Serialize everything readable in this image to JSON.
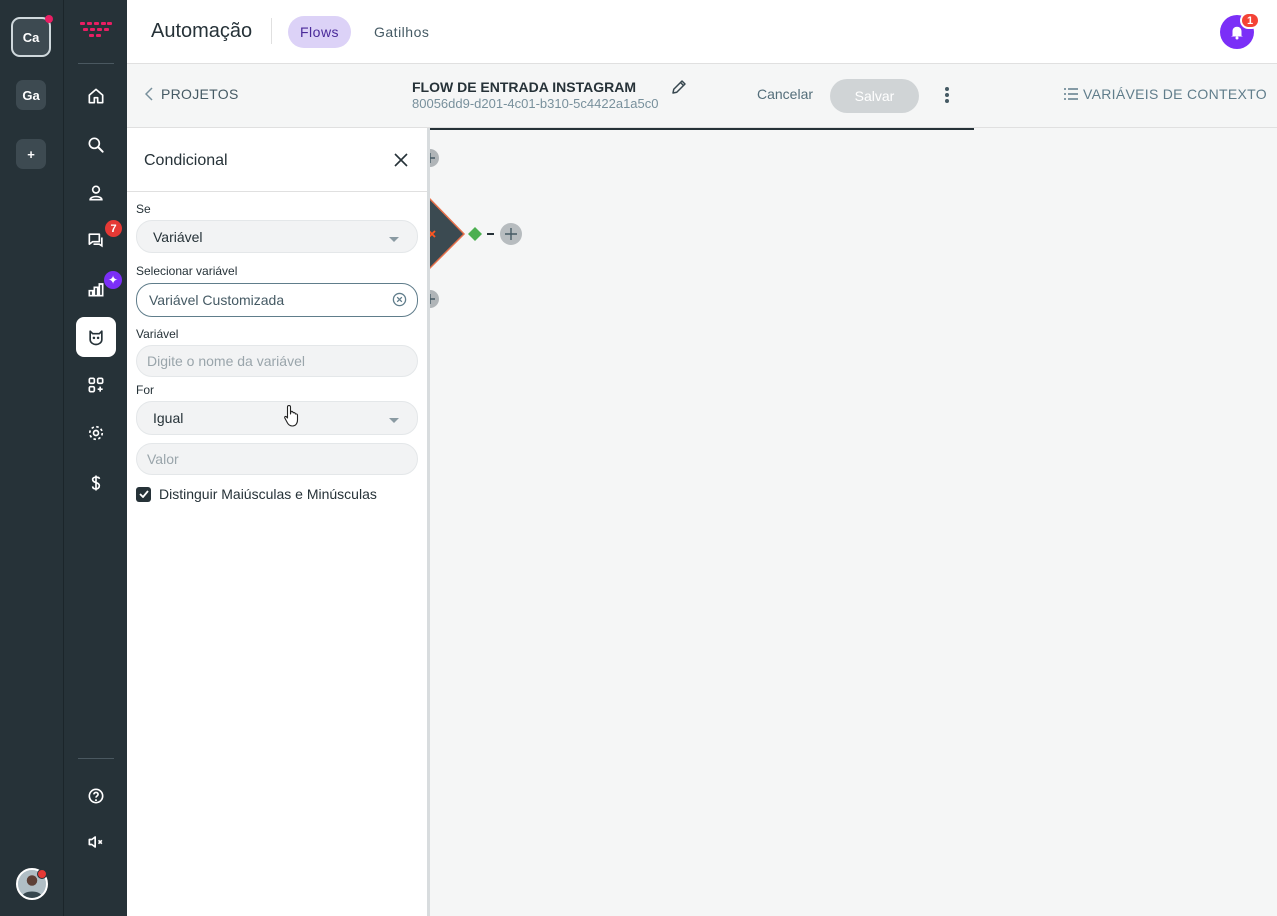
{
  "workspaces": [
    {
      "label": "Ca",
      "active": true
    },
    {
      "label": "Ga",
      "active": false
    },
    {
      "label": "+",
      "active": false
    }
  ],
  "nav": {
    "conversations_badge": "7",
    "ai_badge": "✦",
    "items": [
      "home-icon",
      "search-icon",
      "contacts-icon",
      "conversations-icon",
      "reports-icon",
      "bot-icon",
      "apps-icon",
      "settings-icon",
      "billing-icon",
      "help-icon",
      "sound-off-icon"
    ]
  },
  "header": {
    "title": "Automação",
    "tabs": [
      {
        "label": "Flows",
        "active": true
      },
      {
        "label": "Gatilhos",
        "active": false
      }
    ],
    "notification_count": "1"
  },
  "flowbar": {
    "back_label": "PROJETOS",
    "flow_name": "FLOW DE ENTRADA INSTAGRAM",
    "flow_id": "80056dd9-d201-4c01-b310-5c4422a1a5c0",
    "cancel_label": "Cancelar",
    "save_label": "Salvar",
    "context_vars_label": "VARIÁVEIS DE CONTEXTO"
  },
  "panel": {
    "title": "Condicional",
    "if_label": "Se",
    "if_value": "Variável",
    "select_var_label": "Selecionar variável",
    "select_var_value": "Variável Customizada",
    "var_label": "Variável",
    "var_placeholder": "Digite o nome da variável",
    "for_label": "For",
    "for_value": "Igual",
    "value_placeholder": "Valor",
    "case_sensitive_label": "Distinguir Maiúsculas e Minúsculas",
    "case_sensitive_checked": true
  },
  "colors": {
    "sidebar": "#263238",
    "accent": "#7b2ff7",
    "tab_active_bg": "#dcd2f7",
    "brand_pink": "#e91e63",
    "node_green": "#4caf50"
  }
}
